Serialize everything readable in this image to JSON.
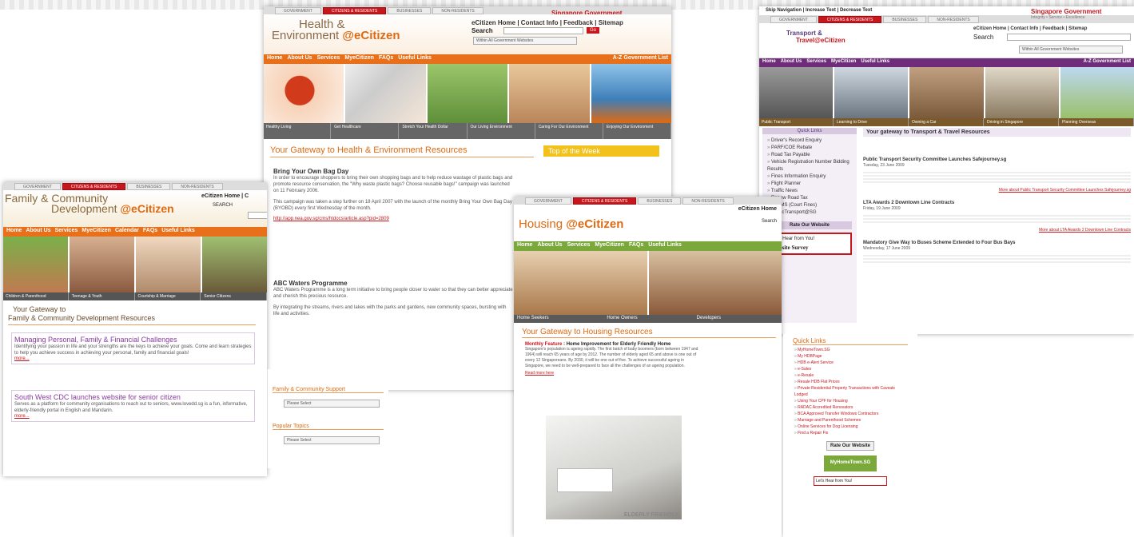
{
  "common": {
    "tabs": [
      "Government",
      "Citizens & Residents",
      "Businesses",
      "Non-Residents"
    ],
    "sg_gov": "Singapore Government",
    "sg_tagline": "Integrity • Service • Excellence"
  },
  "health": {
    "title_line1": "Health &",
    "title_line2": "Environment",
    "brand": "@eCitizen",
    "top_links": "eCitizen Home | Contact Info | Feedback | Sitemap",
    "search_label": "Search",
    "search_go": "Go",
    "search_scope": "Within All Government Websites",
    "menu": [
      "Home",
      "About Us",
      "Services",
      "MyeCitizen",
      "FAQs",
      "Useful Links"
    ],
    "menu_right": "A-Z Government List",
    "captions": [
      "Healthy Living",
      "Get Healthcare",
      "Stretch Your Health Dollar",
      "Our Living Environment",
      "Caring For Our Environment",
      "Enjoying Our Environment"
    ],
    "gateway": "Your Gateway to Health & Environment Resources",
    "top_of_week": "Top of the Week",
    "article1_title": "Bring Your Own Bag Day",
    "article1_p1": "In order to encourage shoppers to bring their own shopping bags and to help reduce wastage of plastic bags and promote resource conservation, the \"Why waste plastic bags? Choose reusable bags!\" campaign was launched on 11 February 2006.",
    "article1_p2": "This campaign was taken a step further on 18 April 2007 with the launch of the monthly Bring Your Own Bag Day (BYOBD) every first Wednesday of the month.",
    "article1_link": "http://app.nea.gov.sg/cms/htdocs/article.asp?pid=2809",
    "article2_title": "ABC Waters Programme",
    "article2_p1": "ABC Waters Programme is a long term initiative to bring people closer to water so that they can better appreciate and cherish this precious resource.",
    "article2_p2": "By integrating the streams, rivers and lakes with the parks and gardens, new community spaces, bursting with life and activities."
  },
  "transport": {
    "skip_nav": "Skip Navigation | Increase Text | Decrease Text",
    "title_line1": "Transport &",
    "title_line2": "Travel@eCitizen",
    "top_links": "eCitizen Home | Contact Info | Feedback | Sitemap",
    "search_label": "Search",
    "search_scope": "Within All Government Websites",
    "menu": [
      "Home",
      "About Us",
      "Services",
      "MyeCitizen",
      "Useful Links"
    ],
    "menu_right": "A-Z Government List",
    "captions": [
      "Public Transport",
      "Learning to Drive",
      "Owning a Car",
      "Driving in Singapore",
      "Planning Overseas"
    ],
    "quick_links_title": "Quick Links",
    "quick_links": [
      "Driver's Record Enquiry",
      "PARF/COE Rebate",
      "Road Tax Payable",
      "Vehicle Registration Number Bidding Results",
      "Fines Information Enquiry",
      "Flight Planner",
      "Traffic News",
      "Renew Road Tax",
      "ATOMS (Court Fines)",
      "PublicTransport@SG"
    ],
    "rate_site": "Rate Our Website",
    "feedback_box": "Let's Hear from You!",
    "website_survey": "Website Survey",
    "gateway": "Your gateway to Transport & Travel Resources",
    "news1_title": "Public Transport Security Committee Launches Safejourney.sg",
    "news1_date": "Tuesday, 23 June 2009",
    "news1_link": "More about Public Transport Security Committee Launches Safejourney.sg",
    "news2_title": "LTA Awards 2 Downtown Line Contracts",
    "news2_date": "Friday, 19 June 2009",
    "news2_link": "More about LTA Awards 2 Downtown Line Contracts",
    "news3_title": "Mandatory Give Way to Buses Scheme Extended to Four Bus Bays",
    "news3_date": "Wednesday, 17 June 2009"
  },
  "family": {
    "title_line1": "Family & Community",
    "title_line2": "Development",
    "brand": "@eCitizen",
    "top_links": "eCitizen Home | C",
    "search_label": "SEARCH",
    "menu": [
      "Home",
      "About Us",
      "Services",
      "MyeCitizen",
      "Calendar",
      "FAQs",
      "Useful Links"
    ],
    "captions": [
      "Children & Parenthood",
      "Teenage & Youth",
      "Courtship & Marriage",
      "Senior Citizens"
    ],
    "gateway_line1": "Your Gateway to",
    "gateway_line2": "Family & Community Development Resources",
    "box1_title": "Managing Personal, Family & Financial Challenges",
    "box1_text": "Identifying your passion in life and your strengths are the keys to achieve your goals. Come and learn strategies to help you achieve success in achieving your personal, family and financial goals!",
    "box1_more": "more...",
    "box2_title": "South West CDC launches website for senior citizen",
    "box2_text": "Serves as a platform for community organisations to reach out to seniors, www.lovedd.sg is a fun, informative, elderly-friendly portal in English and Mandarin.",
    "box2_more": "more...",
    "support_title": "Family & Community Support",
    "popular_title": "Popular Topics",
    "please_select": "Please Select"
  },
  "housing": {
    "top_links": "eCitizen Home",
    "brand_housing": "Housing",
    "brand": "@eCitizen",
    "search_label": "Search",
    "menu": [
      "Home",
      "About Us",
      "Services",
      "MyeCitizen",
      "FAQs",
      "Useful Links"
    ],
    "bars": [
      "Home Seekers",
      "Home Owners",
      "Developers"
    ],
    "gateway": "Your Gateway to Housing Resources",
    "feature_label": "Monthly Feature",
    "feature_title": "Home Improvement for Elderly Friendly Home",
    "feature_text": "Singapore's population is ageing rapidly. The first batch of baby boomers (born between 1947 and 1964) will reach 65 years of age by 2012. The number of elderly aged 65 and above is one out of every 12 Singaporeans. By 2030, it will be one out of five. To achieve successful ageing in Singapore, we need to be well-prepared to face all the challenges of an ageing population.",
    "read_more": "Read more here",
    "image_caption": "ELDERLY FRIENDLY",
    "quick_links_title": "Quick Links",
    "quick_links": [
      "MyHomeTown.SG",
      "My HDBPage",
      "HDB e-Alert Service",
      "e-Sales",
      "e-Resale",
      "Resale HDB Flat Prices",
      "Private Residential Property Transactions with Caveats Lodged",
      "Using Your CPF for Housing",
      "RADAC Accredited Renovators",
      "BCA Approved Transfer Windows Contractors",
      "Marriage and Parenthood Schemes",
      "Online Services for Dog Licensing",
      "Find a Repair Fix"
    ],
    "rate_site": "Rate Our Website",
    "myhometown": "MyHomeTown.SG",
    "feedback_box": "Let's Hear from You!"
  }
}
